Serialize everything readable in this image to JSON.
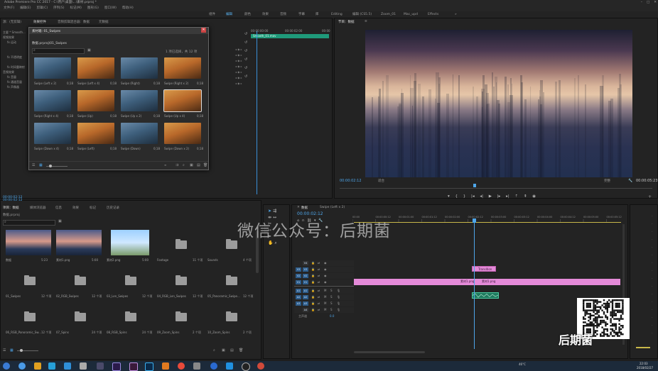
{
  "window": {
    "title": "Adobe Premiere Pro CC 2017 - C:\\用户\\桌面\\...\\素材.prproj *"
  },
  "menu": [
    "文件(F)",
    "编辑(E)",
    "剪辑(C)",
    "序列(S)",
    "标记(M)",
    "图形(G)",
    "窗口(W)",
    "帮助(H)"
  ],
  "workspaces": [
    {
      "label": "组件",
      "active": false
    },
    {
      "label": "编辑",
      "active": true
    },
    {
      "label": "颜色",
      "active": false
    },
    {
      "label": "效果",
      "active": false
    },
    {
      "label": "音频",
      "active": false
    },
    {
      "label": "字幕",
      "active": false
    },
    {
      "label": "库",
      "active": false
    },
    {
      "label": "Editing",
      "active": false
    },
    {
      "label": "编辑 (CS5.5)",
      "active": false
    },
    {
      "label": "Zoom_01",
      "active": false
    },
    {
      "label": "Mac_upd",
      "active": false
    },
    {
      "label": "Effects",
      "active": false
    }
  ],
  "source_panel": {
    "tabs": [
      "源：(无剪辑)",
      "效果控件",
      "音频剪辑混合器：数据",
      "元数据"
    ],
    "rows": [
      "主要 * Smooth...",
      "视频效果",
      "fx 运动",
      "fx 不透明度",
      "fx 时间重映射",
      "音频效果",
      "fx 音量",
      "fx 通道音量",
      "fx 声像器"
    ],
    "seq_name": "Smooth_01.mov",
    "time_ticks": [
      "00:00:00:00",
      "00:00:02:00",
      "00:00"
    ],
    "timecode": "00:00:02:12"
  },
  "bin_window": {
    "title": "素材箱: 01_Swipes",
    "path": "数据.prproj\\01_Swipes",
    "search_placeholder": "",
    "selection_info": "1 项已选择，共 12 项",
    "items": [
      {
        "name": "Swipe (Left x 2)",
        "dur": "0;18",
        "tone": "blue"
      },
      {
        "name": "Swipe (Left x 4)",
        "dur": "0;18",
        "tone": "warm"
      },
      {
        "name": "Swipe (Right)",
        "dur": "0;18",
        "tone": "blue"
      },
      {
        "name": "Swipe (Right x 2)",
        "dur": "0;18",
        "tone": "warm"
      },
      {
        "name": "Swipe (Right x 4)",
        "dur": "0;18",
        "tone": "blue"
      },
      {
        "name": "Swipe (Up)",
        "dur": "0;18",
        "tone": "warm"
      },
      {
        "name": "Swipe (Up x 2)",
        "dur": "0;18",
        "tone": "blue"
      },
      {
        "name": "Swipe (Up x 4)",
        "dur": "0;18",
        "tone": "warm"
      },
      {
        "name": "Swipe (Down x 4)",
        "dur": "0;18",
        "tone": "blue"
      },
      {
        "name": "Swipe (Left)",
        "dur": "0;18",
        "tone": "warm"
      },
      {
        "name": "Swipe (Down)",
        "dur": "0;18",
        "tone": "blue"
      },
      {
        "name": "Swipe (Down x 2)",
        "dur": "0;18",
        "tone": "warm"
      }
    ]
  },
  "program_monitor": {
    "tab": "节目：数据",
    "timecode_left": "00:00:02:12",
    "fit": "适合",
    "quality": "完整",
    "timecode_right": "00:00:05:23"
  },
  "project_panel": {
    "timecode": "00:00:02:12",
    "tabs": [
      "项目：数据",
      "媒体浏览器",
      "信息",
      "效果",
      "标记",
      "历史记录"
    ],
    "project_name": "数据.prproj",
    "items": [
      {
        "name": "数据",
        "dur": "5:23",
        "kind": "seq"
      },
      {
        "name": "素材1.png",
        "dur": "5:00",
        "kind": "city"
      },
      {
        "name": "素材2.png",
        "dur": "5:00",
        "kind": "photo"
      },
      {
        "name": "Footage",
        "dur": "11 个项",
        "kind": "folder"
      },
      {
        "name": "Sounds",
        "dur": "4 个项",
        "kind": "folder"
      },
      {
        "name": "01_Swipes",
        "dur": "12 个项",
        "kind": "folder"
      },
      {
        "name": "02_RGB_Swipes",
        "dur": "12 个项",
        "kind": "folder"
      },
      {
        "name": "03_Len_Swipes",
        "dur": "12 个项",
        "kind": "folder"
      },
      {
        "name": "04_RGB_Len_Swipes",
        "dur": "12 个项",
        "kind": "folder"
      },
      {
        "name": "05_Panoramic_Swipe...",
        "dur": "12 个项",
        "kind": "folder"
      },
      {
        "name": "06_RGB_Panoramic_Sw...",
        "dur": "12 个项",
        "kind": "folder"
      },
      {
        "name": "07_Spins",
        "dur": "24 个项",
        "kind": "folder"
      },
      {
        "name": "08_RGB_Spins",
        "dur": "24 个项",
        "kind": "folder"
      },
      {
        "name": "09_Zoom_Spins",
        "dur": "2 个项",
        "kind": "folder"
      },
      {
        "name": "10_Zoom_Spins",
        "dur": "2 个项",
        "kind": "folder"
      }
    ]
  },
  "timeline": {
    "tabs": [
      "数据",
      "Swipe (Left x 2)"
    ],
    "timecode": "00:00:02:12",
    "ruler": [
      "00:00",
      "00:00:00:12",
      "00:00:01:00",
      "00:00:01:12",
      "00:00:02:00",
      "00:00:02:12",
      "00:00:03:00",
      "00:00:03:12",
      "00:00:04:00",
      "00:00:04:12",
      "00:00:05:00",
      "00:00:05:12"
    ],
    "tracks": [
      "V4",
      "V3",
      "V2",
      "V1",
      "A1",
      "A2",
      "A3",
      "A4"
    ],
    "master": "主声道",
    "master_val": "0.0",
    "clips": {
      "transition": "Transition",
      "v1_a": "素材1.png",
      "v1_b": "素材1.png"
    }
  },
  "watermark": {
    "text": "微信公众号：后期菌",
    "logo_text": "后期菌"
  },
  "taskbar": {
    "time": "22:03",
    "date": "2018/02/27",
    "status": "46°C"
  }
}
